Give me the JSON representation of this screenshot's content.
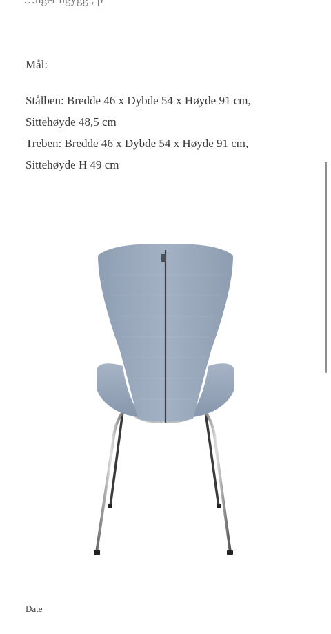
{
  "truncated_text": "... nger  ... ngygg... , ... p",
  "section": {
    "heading": "Mål:",
    "specs": [
      "Stålben: Bredde 46 x Dybde 54 x Høyde 91 cm,",
      "Sittehøyde 48,5 cm",
      "Treben: Bredde 46 x Dybde 54 x Høyde 91 cm,",
      "Sittehøyde H 49 cm"
    ]
  },
  "image": {
    "subject": "chair-back-view",
    "upholstery_color": "#9aa9bd",
    "leg_color": "#b8b8b8"
  },
  "footer": {
    "label": "Date"
  }
}
